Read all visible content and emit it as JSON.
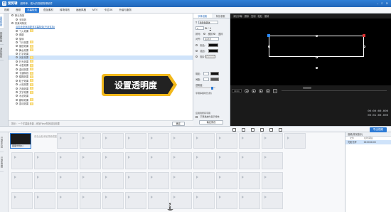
{
  "window": {
    "title": "爱剪辑",
    "subtitle": "超简单、强大的视频剪辑软件",
    "logo": "剪"
  },
  "menu": {
    "items": [
      "视频",
      "音频",
      "字幕特效",
      "叠加素材",
      "转场特效",
      "画面风格",
      "MTV",
      "卡拉OK",
      "升级与服务"
    ],
    "active_index": 2
  },
  "sidebar": {
    "tabs": [
      "出现特效",
      "停留特效",
      "消失特效"
    ]
  },
  "effects": {
    "tree": [
      {
        "label": "默认特效",
        "level": 0
      },
      {
        "label": "无特效",
        "level": 1
      },
      {
        "label": "好莱坞特效",
        "level": 0
      },
      {
        "label": "点击此处添加更多字幕特效(只对支持)",
        "level": 1,
        "link": true
      },
      {
        "label": "飞入效果",
        "level": 1,
        "tag": "新"
      },
      {
        "label": "弹跳",
        "level": 1
      },
      {
        "label": "旋转",
        "level": 1
      },
      {
        "label": "飞行效果",
        "level": 1,
        "tag": "新"
      },
      {
        "label": "缩放效果",
        "level": 1,
        "tag": "新"
      },
      {
        "label": "舞台效果",
        "level": 1,
        "tag": "新"
      },
      {
        "label": "打字效果",
        "level": 1
      },
      {
        "label": "光影效果",
        "level": 1,
        "tag": "新",
        "selected": true
      },
      {
        "label": "扫光效果",
        "level": 1,
        "tag": "新"
      },
      {
        "label": "水墨效果",
        "level": 1,
        "tag": "新"
      },
      {
        "label": "曲线效果",
        "level": 1,
        "tag": "新"
      },
      {
        "label": "卡通特效",
        "level": 1,
        "tag": "新"
      },
      {
        "label": "模糊效果",
        "level": 1,
        "tag": "新"
      },
      {
        "label": "粒子效果",
        "level": 1,
        "tag": "新"
      },
      {
        "label": "火焰效果",
        "level": 1,
        "tag": "新"
      },
      {
        "label": "古典效果",
        "level": 1,
        "tag": "新"
      },
      {
        "label": "文字效果",
        "level": 1,
        "tag": "新"
      },
      {
        "label": "水波效果",
        "level": 1
      },
      {
        "label": "翻转效果",
        "level": 1,
        "tag": "新"
      },
      {
        "label": "震动效果",
        "level": 1,
        "tag": "新"
      }
    ],
    "tip": "提示：一个字幕最多能...添加Flash特效增加效果",
    "tip_button": "确定"
  },
  "props": {
    "tabs": [
      "字体设置",
      "特效参数"
    ],
    "font": "微软雅黑体",
    "size": "5",
    "style_label": "排列：",
    "align_options": [
      "横排",
      "竖排"
    ],
    "align_label": "对齐：",
    "align_value": "左对齐",
    "color_label": "颜色：",
    "stroke_label": "描边：",
    "shadow_label": "阴影：",
    "bg_label": "图片",
    "opacity_label": "透明度：",
    "opacity_value": "",
    "rotate_label": "旋转：",
    "spacing_label": "间距：",
    "duration_label": "字幕停留时长(秒)",
    "apply_label": "应用到所有字幕",
    "check_label": "字幕播放时显示特效",
    "save_button": "确定修改"
  },
  "callout": {
    "text": "设置透明度",
    "color": "#f2b81b"
  },
  "preview": {
    "toolbar": [
      "添加字幕",
      "删除",
      "复制",
      "粘贴",
      "撤销"
    ],
    "time_input": "00:00",
    "current_time": "00:00:00.000",
    "total_time": "00:01:00.000",
    "bottom_time": "00:00:00.000"
  },
  "toolbar": {
    "export_label": "导出视频"
  },
  "timeline": {
    "track_labels": [
      "已添加片段",
      "已添加音频"
    ],
    "clip_label": "星星光线(1)",
    "hint": "双击此处添加视频或图片"
  },
  "subpanel": {
    "title": "音频(背景音乐)",
    "headers": [
      "文件",
      "在时间轴"
    ],
    "rows": [
      {
        "name": "光影光环",
        "time": "00:00:00.00"
      }
    ]
  }
}
